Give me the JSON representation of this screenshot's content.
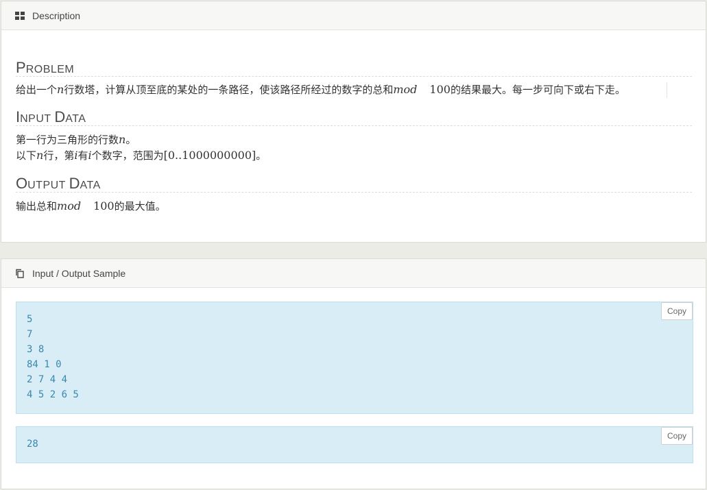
{
  "description_panel": {
    "title": "Description",
    "problem": {
      "heading_first": "P",
      "heading_rest": "ROBLEM",
      "text_1": "给出一个",
      "var_n": "n",
      "text_2": "行数塔，计算从顶至底的某处的一条路径，使该路径所经过的数字的总和",
      "mod": "mod",
      "num": "100",
      "text_3": "的结果最大。每一步可向下或右下走。"
    },
    "input_data": {
      "heading_first_1": "I",
      "heading_rest_1": "NPUT ",
      "heading_first_2": "D",
      "heading_rest_2": "ATA",
      "line1_text": "第一行为三角形的行数",
      "line1_var": "n",
      "line1_end": "。",
      "line2_a": "以下",
      "line2_var_n": "n",
      "line2_b": "行，第",
      "line2_var_i1": "i",
      "line2_c": "有",
      "line2_var_i2": "i",
      "line2_d": "个数字，范围为",
      "line2_range": "[0..1000000000]",
      "line2_end": "。"
    },
    "output_data": {
      "heading_first_1": "O",
      "heading_rest_1": "UTPUT ",
      "heading_first_2": "D",
      "heading_rest_2": "ATA",
      "text_1": "输出总和",
      "mod": "mod",
      "num": "100",
      "text_2": "的最大值。"
    }
  },
  "sample_panel": {
    "title": "Input / Output Sample",
    "input_sample": "5\n7\n3 8\n84 1 0\n2 7 4 4\n4 5 2 6 5",
    "output_sample": "28",
    "copy_label": "Copy"
  }
}
